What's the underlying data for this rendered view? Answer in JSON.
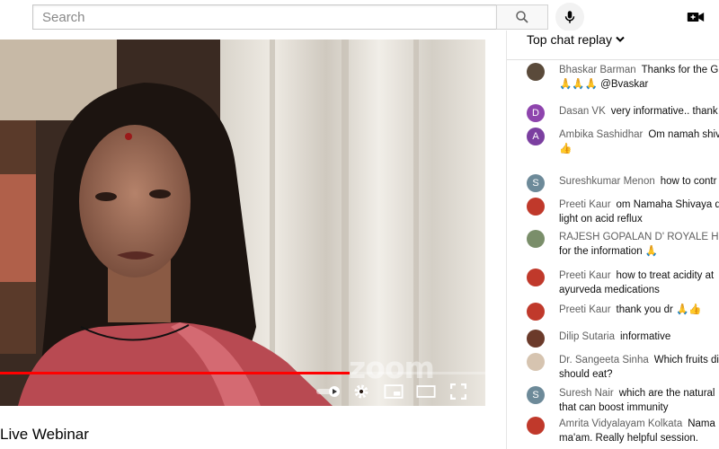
{
  "search": {
    "placeholder": "Search"
  },
  "video": {
    "title": "Live Webinar",
    "watermark": "zoom",
    "progress_fraction": 0.72
  },
  "chat": {
    "header": "Top chat replay",
    "messages": [
      {
        "author": "Bhaskar Barman",
        "lines": [
          "Thanks for the G",
          "🙏🙏🙏 @Bvaskar"
        ],
        "avatar": "",
        "avatar_color": "#5a4a3a"
      },
      {
        "author": "Dasan VK",
        "lines": [
          "very informative.. thank"
        ],
        "avatar": "D",
        "avatar_color": "#8e44ad"
      },
      {
        "author": "Ambika Sashidhar",
        "lines": [
          "Om namah shiv",
          "👍"
        ],
        "avatar": "A",
        "avatar_color": "#7b3fa0"
      },
      {
        "author": "Sureshkumar Menon",
        "lines": [
          "how to contr"
        ],
        "avatar": "S",
        "avatar_color": "#6d8a99"
      },
      {
        "author": "Preeti Kaur",
        "lines": [
          "om Namaha Shivaya d",
          "light on acid reflux"
        ],
        "avatar": "",
        "avatar_color": "#c0392b"
      },
      {
        "author": "RAJESH GOPALAN D' ROYALE HOL",
        "lines": [
          "",
          "for the information 🙏"
        ],
        "avatar": "",
        "avatar_color": "#7a8e6a"
      },
      {
        "author": "Preeti Kaur",
        "lines": [
          "how to treat acidity at",
          "ayurveda medications"
        ],
        "avatar": "",
        "avatar_color": "#c0392b"
      },
      {
        "author": "Preeti Kaur",
        "lines": [
          "thank you dr 🙏👍"
        ],
        "avatar": "",
        "avatar_color": "#c0392b"
      },
      {
        "author": "Dilip Sutaria",
        "lines": [
          "informative"
        ],
        "avatar": "",
        "avatar_color": "#6b3a2a"
      },
      {
        "author": "Dr. Sangeeta Sinha",
        "lines": [
          "Which fruits di",
          "should eat?"
        ],
        "avatar": "",
        "avatar_color": "#d6c4b0"
      },
      {
        "author": "Suresh Nair",
        "lines": [
          "which are the natural",
          "that can boost immunity"
        ],
        "avatar": "S",
        "avatar_color": "#6d8a99"
      },
      {
        "author": "Amrita Vidyalayam Kolkata",
        "lines": [
          "Nama",
          "ma'am. Really helpful session."
        ],
        "avatar": "",
        "avatar_color": "#c0392b"
      }
    ]
  }
}
